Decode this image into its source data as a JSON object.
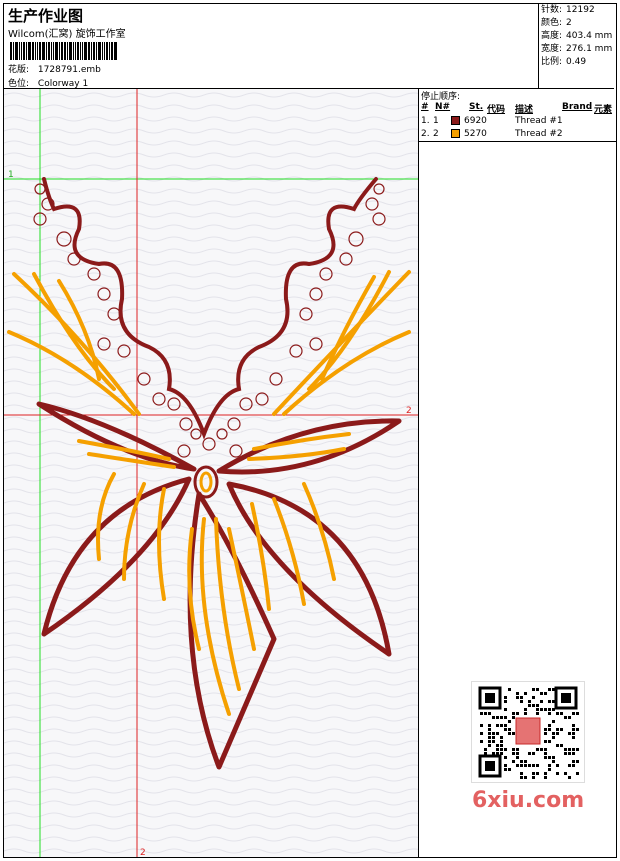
{
  "header": {
    "title": "生产作业图",
    "studio": "Wilcom(汇窝) 旋饰工作室",
    "design_label": "花版:",
    "design_file": "1728791.emb",
    "colorway_label": "色位:",
    "colorway": "Colorway 1"
  },
  "stats": [
    {
      "label": "针数:",
      "value": "12192"
    },
    {
      "label": "颜色:",
      "value": "2"
    },
    {
      "label": "高度:",
      "value": "403.4 mm"
    },
    {
      "label": "宽度:",
      "value": "276.1 mm"
    },
    {
      "label": "比例:",
      "value": "0.49"
    }
  ],
  "stop_sequence": {
    "title": "停止顺序:",
    "headers": {
      "num": "#",
      "n": "N#",
      "st": "St.",
      "code": "代码",
      "desc": "描述",
      "brand": "Brand",
      "elem": "元素"
    },
    "rows": [
      {
        "num": "1.",
        "n": "1",
        "code": "6920",
        "desc": "Thread #1",
        "color": "#8b1a1a"
      },
      {
        "num": "2.",
        "n": "2",
        "code": "5270",
        "desc": "Thread #2",
        "color": "#f5a000"
      }
    ]
  },
  "guides": {
    "h_label_left": "1",
    "h_label_right": "2",
    "v_label_bottom": "2"
  },
  "watermark": "6xiu.com",
  "colors": {
    "thread1": "#8b1a1a",
    "thread2": "#f5a000",
    "guide_green": "#22dd22",
    "guide_red": "#dd2222"
  }
}
